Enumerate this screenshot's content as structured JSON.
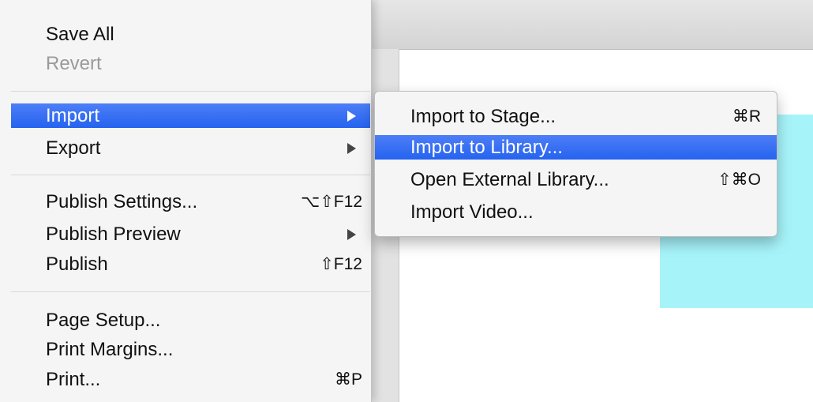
{
  "main_menu": {
    "items": [
      {
        "label": "Save All",
        "shortcut": "",
        "state": "normal"
      },
      {
        "label": "Revert",
        "shortcut": "",
        "state": "disabled"
      },
      {
        "label": "Import",
        "shortcut": "",
        "state": "highlighted",
        "submenu": true
      },
      {
        "label": "Export",
        "shortcut": "",
        "state": "normal",
        "submenu": true
      },
      {
        "label": "Publish Settings...",
        "shortcut": "⌥⇧F12",
        "state": "normal"
      },
      {
        "label": "Publish Preview",
        "shortcut": "",
        "state": "normal",
        "submenu": true
      },
      {
        "label": "Publish",
        "shortcut": "⇧F12",
        "state": "normal"
      },
      {
        "label": "Page Setup...",
        "shortcut": "",
        "state": "normal"
      },
      {
        "label": "Print Margins...",
        "shortcut": "",
        "state": "normal"
      },
      {
        "label": "Print...",
        "shortcut": "⌘P",
        "state": "normal"
      }
    ]
  },
  "submenu": {
    "items": [
      {
        "label": "Import to Stage...",
        "shortcut": "⌘R",
        "state": "normal"
      },
      {
        "label": "Import to Library...",
        "shortcut": "",
        "state": "highlighted"
      },
      {
        "label": "Open External Library...",
        "shortcut": "⇧⌘O",
        "state": "normal"
      },
      {
        "label": "Import Video...",
        "shortcut": "",
        "state": "normal"
      }
    ]
  },
  "colors": {
    "highlight": "#2f6cf2",
    "menu_bg": "#f5f5f5",
    "stage_shape": "#a6f4fa"
  }
}
